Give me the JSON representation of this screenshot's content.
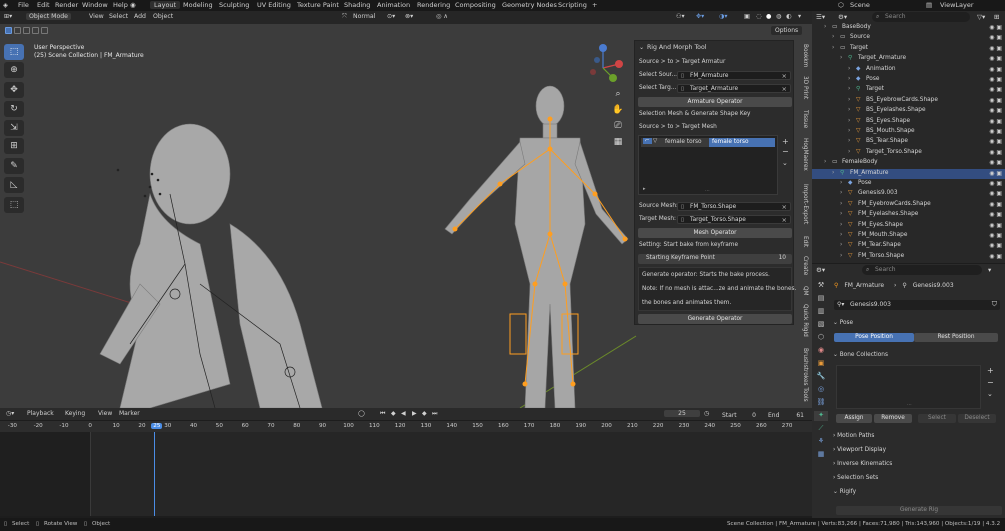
{
  "menu": {
    "items": [
      "File",
      "Edit",
      "Render",
      "Window",
      "Help"
    ],
    "workspaces": [
      "Layout",
      "Modeling",
      "Sculpting",
      "UV Editing",
      "Texture Paint",
      "Shading",
      "Animation",
      "Rendering",
      "Compositing",
      "Geometry Nodes",
      "Scripting"
    ],
    "add_tab": "+",
    "scene": "Scene",
    "view_layer": "ViewLayer"
  },
  "viewport_header": {
    "mode": "Object Mode",
    "menus": [
      "View",
      "Select",
      "Add",
      "Object"
    ],
    "transform": "Normal",
    "options": "Options"
  },
  "viewport": {
    "perspective": "User Perspective",
    "collection": "(25) Scene Collection | FM_Armature",
    "side_tabs": [
      "Bookkm",
      "3D Print",
      "Tissue",
      "HogMaerex",
      "Import-Export",
      "Edit",
      "Create",
      "QM",
      "Quick Rigid",
      "Brushstrokes Tools"
    ]
  },
  "rig_panel": {
    "title": "Rig And Morph Tool",
    "source_to_target_armature": "Source > to > Target Armatur",
    "select_source_label": "Select Sour...",
    "select_source_value": "FM_Armature",
    "select_target_label": "Select Targ...",
    "select_target_value": "Target_Armature",
    "armature_operator": "Armature Operator",
    "selection_mesh_label": "Selection Mesh & Generate Shape Key",
    "source_to_target_mesh": "Source > to > Target Mesh",
    "list_item_name": "female torso",
    "list_item_value": "female torso",
    "source_mesh_label": "Source Mesh:",
    "source_mesh_value": "FM_Torso.Shape",
    "target_mesh_label": "Target Mesh:",
    "target_mesh_value": "Target_Torso.Shape",
    "mesh_operator": "Mesh Operator",
    "setting_label": "Setting: Start bake from keyframe",
    "start_keyframe_label": "Starting Keyframe Point",
    "start_keyframe_value": "10",
    "info_line1": "Generate operator: Starts the bake process.",
    "info_line2": "Note: If no mesh is attac...ze and animate the bones.",
    "info_line3": "the bones and animates them.",
    "generate_operator": "Generate Operator"
  },
  "timeline": {
    "menus": [
      "Playback",
      "Keying",
      "View",
      "Marker"
    ],
    "current_frame": "25",
    "start_label": "Start",
    "start_value": "0",
    "end_label": "End",
    "end_value": "61",
    "ruler": [
      "-30",
      "-20",
      "-10",
      "0",
      "10",
      "20",
      "25",
      "30",
      "40",
      "50",
      "60",
      "70",
      "80",
      "90",
      "100",
      "110",
      "120",
      "130",
      "140",
      "150",
      "160",
      "170",
      "180",
      "190",
      "200",
      "210",
      "220",
      "230",
      "240",
      "250",
      "260",
      "270"
    ]
  },
  "outliner": {
    "search_placeholder": "Search",
    "rows": [
      {
        "label": "BaseBody",
        "indent": 1
      },
      {
        "label": "Source",
        "indent": 2
      },
      {
        "label": "Target",
        "indent": 2
      },
      {
        "label": "Target_Armature",
        "indent": 3
      },
      {
        "label": "Animation",
        "indent": 4
      },
      {
        "label": "Pose",
        "indent": 4
      },
      {
        "label": "Target",
        "indent": 4
      },
      {
        "label": "BS_EyebrowCards.Shape",
        "indent": 4
      },
      {
        "label": "BS_Eyelashes.Shape",
        "indent": 4
      },
      {
        "label": "BS_Eyes.Shape",
        "indent": 4
      },
      {
        "label": "BS_Mouth.Shape",
        "indent": 4
      },
      {
        "label": "BS_Tear.Shape",
        "indent": 4
      },
      {
        "label": "Target_Torso.Shape",
        "indent": 4
      },
      {
        "label": "FemaleBody",
        "indent": 1
      },
      {
        "label": "FM_Armature",
        "indent": 2
      },
      {
        "label": "Pose",
        "indent": 3
      },
      {
        "label": "Genesis9.003",
        "indent": 3
      },
      {
        "label": "FM_EyebrowCards.Shape",
        "indent": 3
      },
      {
        "label": "FM_Eyelashes.Shape",
        "indent": 3
      },
      {
        "label": "FM_Eyes.Shape",
        "indent": 3
      },
      {
        "label": "FM_Mouth.Shape",
        "indent": 3
      },
      {
        "label": "FM_Tear.Shape",
        "indent": 3
      },
      {
        "label": "FM_Torso.Shape",
        "indent": 3
      }
    ]
  },
  "properties": {
    "search_placeholder": "Search",
    "breadcrumb_object": "FM_Armature",
    "breadcrumb_data": "Genesis9.003",
    "data_name": "Genesis9.003",
    "pose_section": "Pose",
    "pose_position": "Pose Position",
    "rest_position": "Rest Position",
    "bone_collections": "Bone Collections",
    "assign": "Assign",
    "remove": "Remove",
    "select": "Select",
    "deselect": "Deselect",
    "sections": [
      "Motion Paths",
      "Viewport Display",
      "Inverse Kinematics",
      "Selection Sets",
      "Rigify"
    ],
    "generate_rig": "Generate Rig"
  },
  "status": {
    "select": "Select",
    "rotate_view": "Rotate View",
    "object": "Object",
    "stats": "Scene Collection | FM_Armature | Verts:83,266 | Faces:71,980 | Tris:143,960 | Objects:1/19 | 4.3.2"
  },
  "colors": {
    "accent_blue": "#4772b3",
    "armature_orange": "#ff9e1f",
    "playhead": "#4b8de6",
    "viewport_bg": "#3c3c3c"
  }
}
